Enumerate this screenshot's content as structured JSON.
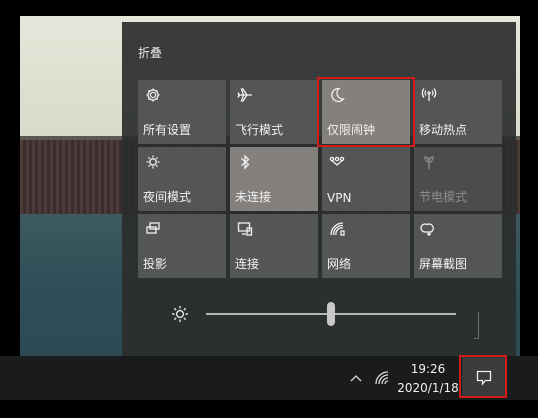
{
  "action_center": {
    "collapse_label": "折叠",
    "tiles": [
      {
        "label": "所有设置",
        "icon": "gear-icon",
        "state": "off"
      },
      {
        "label": "飞行模式",
        "icon": "airplane-icon",
        "state": "off"
      },
      {
        "label": "仅限闹钟",
        "icon": "moon-icon",
        "state": "on"
      },
      {
        "label": "移动热点",
        "icon": "hotspot-icon",
        "state": "off"
      },
      {
        "label": "夜间模式",
        "icon": "night-light-icon",
        "state": "off"
      },
      {
        "label": "未连接",
        "icon": "bluetooth-icon",
        "state": "on"
      },
      {
        "label": "VPN",
        "icon": "vpn-icon",
        "state": "off"
      },
      {
        "label": "节电模式",
        "icon": "battery-saver-icon",
        "state": "disabled"
      },
      {
        "label": "投影",
        "icon": "project-icon",
        "state": "off"
      },
      {
        "label": "连接",
        "icon": "connect-icon",
        "state": "off"
      },
      {
        "label": "网络",
        "icon": "network-icon",
        "state": "off"
      },
      {
        "label": "屏幕截图",
        "icon": "screen-snip-icon",
        "state": "off"
      }
    ],
    "brightness": {
      "icon": "brightness-icon",
      "level_fraction": 0.5
    }
  },
  "taskbar": {
    "time": "19:26",
    "date": "2020/1/18",
    "tray_icons": [
      "chevron-up-icon",
      "wifi-icon"
    ],
    "notification_button_icon": "notification-icon"
  },
  "colors": {
    "highlight": "#d11b1b",
    "tile_off": "#535556",
    "tile_on": "#84807e"
  }
}
